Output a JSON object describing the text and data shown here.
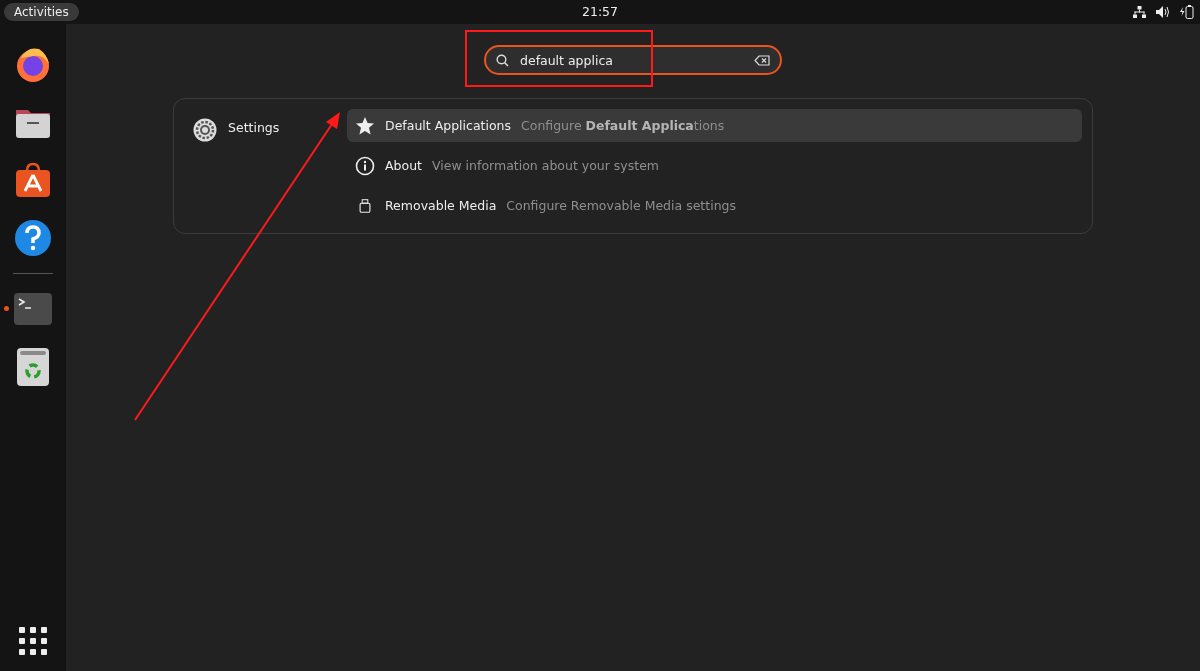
{
  "top_bar": {
    "activities": "Activities",
    "clock": "21:57"
  },
  "dock": {
    "favorites": [
      {
        "kind": "firefox",
        "running": false
      },
      {
        "kind": "files",
        "running": false
      },
      {
        "kind": "app-center",
        "running": false
      },
      {
        "kind": "help",
        "running": false
      }
    ],
    "others": [
      {
        "kind": "terminal",
        "running": true
      },
      {
        "kind": "trash",
        "running": false
      }
    ]
  },
  "search": {
    "value": "default applica"
  },
  "results": {
    "provider": "Settings",
    "items": [
      {
        "kind": "star",
        "title": "Default Applications",
        "description": "Configure **Default Applica**tions",
        "selected": true
      },
      {
        "kind": "info",
        "title": "About",
        "description": "View information about your system",
        "selected": false
      },
      {
        "kind": "usb",
        "title": "Removable Media",
        "description": "Configure Removable Media settings",
        "selected": false
      }
    ]
  }
}
